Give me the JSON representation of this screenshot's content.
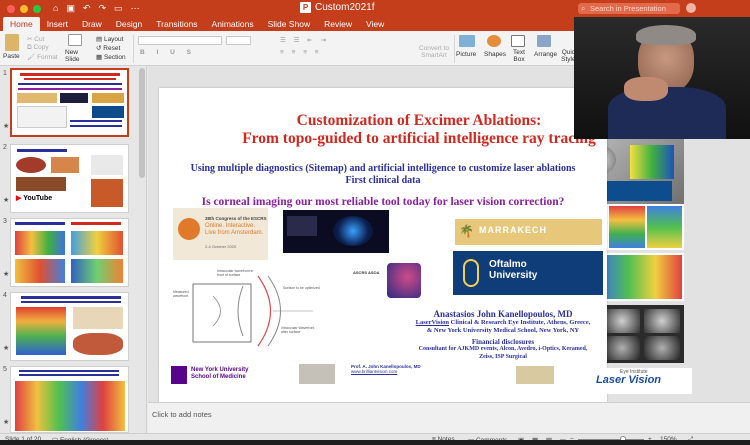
{
  "app": {
    "document_title": "Custom2021f",
    "search_placeholder": "Search in Presentation"
  },
  "tabs": [
    "Home",
    "Insert",
    "Draw",
    "Design",
    "Transitions",
    "Animations",
    "Slide Show",
    "Review",
    "View"
  ],
  "ribbon": {
    "paste": "Paste",
    "cut": "Cut",
    "copy": "Copy",
    "format": "Format",
    "new_slide": "New Slide",
    "layout": "Layout",
    "reset": "Reset",
    "section": "Section",
    "convert_smartart": "Convert to SmartArt",
    "picture": "Picture",
    "shapes": "Shapes",
    "text_box": "Text Box",
    "arrange": "Arrange",
    "quick_styles": "Quick Styles"
  },
  "thumbnails": [
    {
      "number": "1",
      "starred": true
    },
    {
      "number": "2",
      "starred": true
    },
    {
      "number": "3",
      "starred": true
    },
    {
      "number": "4",
      "starred": true
    },
    {
      "number": "5",
      "starred": true
    }
  ],
  "slide": {
    "title_line1": "Customization of Excimer Ablations:",
    "title_line2": "From topo-guided to artificial intelligence ray tracing",
    "subtitle_line1": "Using multiple diagnostics (Sitemap) and artificial intelligence to customize laser ablations",
    "subtitle_line2": "First clinical data",
    "question": "Is corneal imaging our most reliable tool today for laser vision correction?",
    "escrs_title": "38th Congress of the ESCRS",
    "escrs_tagline1": "Online. Interactive.",
    "escrs_tagline2": "Live from Amsterdam.",
    "escrs_date": "2-4 October 2020",
    "marrakech": "MARRAKECH",
    "oftalmo": "Oftalmo",
    "oftalmo2": "University",
    "author_name": "Anastasios John Kanellopoulos, MD",
    "affil_line1_u": "LaserVision",
    "affil_line1": " Clinical & Research Eye Institute, Athens, Greece,",
    "affil_line2": "& New York University Medical School, New York, NY",
    "disclosures": "Financial disclosures",
    "consult_line1": "Consultant for AJKMD events, Alcon, Avedro, i-Optics, Keramed,",
    "consult_line2": "Zeiss, ISP Surgical",
    "nyu1": "New York University",
    "nyu2": "School of Medicine",
    "prof": "Prof. A. John Kanellopoulos, MD",
    "website": "www.brilliantvision.com",
    "laservision": "Laser Vision",
    "eye_institute": "Eye Institute",
    "ascrs": "ASCRS  ASOA",
    "diagram_labels": [
      "Intraocular wavefront in front of surface",
      "Measured wavefront",
      "Surface to be optimized",
      "Intraocular Wavefront after surface"
    ]
  },
  "notes_placeholder": "Click to add notes",
  "status": {
    "slide_info": "Slide 1 of 20",
    "language": "English (Greece)",
    "notes": "Notes",
    "comments": "Comments",
    "zoom": "150%"
  },
  "colors": {
    "accent": "#c43e1c",
    "title_red": "#d1281f",
    "subtitle_blue": "#2b2f9c",
    "question_purple": "#8a1fa0"
  }
}
